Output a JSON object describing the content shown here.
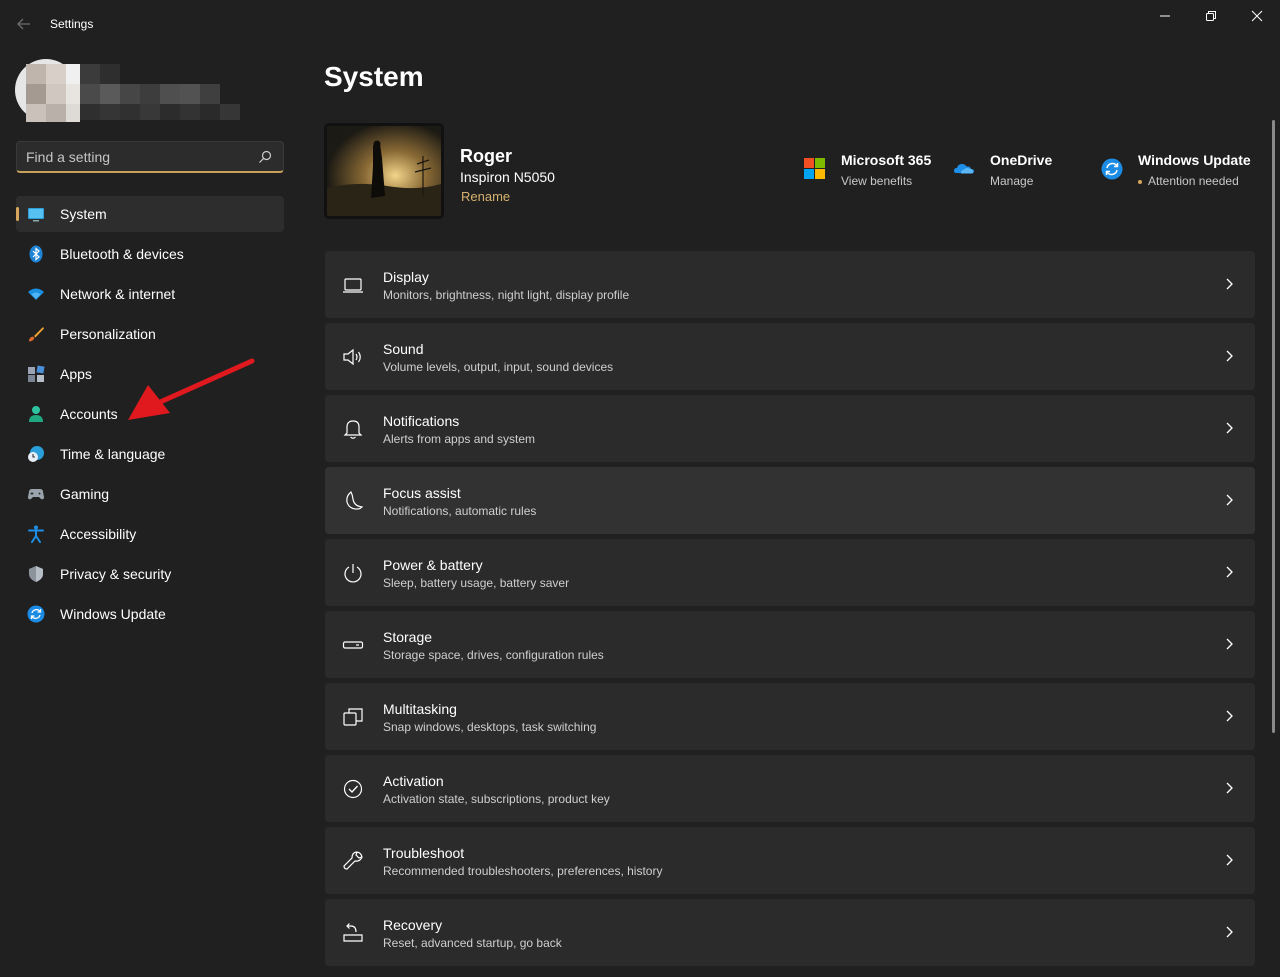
{
  "titlebar": {
    "app_title": "Settings"
  },
  "search": {
    "placeholder": "Find a setting"
  },
  "sidebar": {
    "items": [
      {
        "label": "System",
        "icon": "system-icon",
        "selected": true
      },
      {
        "label": "Bluetooth & devices",
        "icon": "bluetooth-icon"
      },
      {
        "label": "Network & internet",
        "icon": "wifi-icon"
      },
      {
        "label": "Personalization",
        "icon": "brush-icon"
      },
      {
        "label": "Apps",
        "icon": "apps-icon"
      },
      {
        "label": "Accounts",
        "icon": "account-icon"
      },
      {
        "label": "Time & language",
        "icon": "clock-globe-icon"
      },
      {
        "label": "Gaming",
        "icon": "gamepad-icon"
      },
      {
        "label": "Accessibility",
        "icon": "accessibility-icon"
      },
      {
        "label": "Privacy & security",
        "icon": "shield-icon"
      },
      {
        "label": "Windows Update",
        "icon": "windows-update-icon"
      }
    ]
  },
  "main": {
    "title": "System",
    "device": {
      "name": "Roger",
      "model": "Inspiron N5050",
      "rename_label": "Rename"
    },
    "quick_links": {
      "ms365": {
        "title": "Microsoft 365",
        "subtitle": "View benefits"
      },
      "onedrive": {
        "title": "OneDrive",
        "subtitle": "Manage"
      },
      "windows_update": {
        "title": "Windows Update",
        "subtitle": "Attention needed"
      }
    },
    "cards": [
      {
        "title": "Display",
        "subtitle": "Monitors, brightness, night light, display profile",
        "icon": "display-icon"
      },
      {
        "title": "Sound",
        "subtitle": "Volume levels, output, input, sound devices",
        "icon": "speaker-icon"
      },
      {
        "title": "Notifications",
        "subtitle": "Alerts from apps and system",
        "icon": "bell-icon"
      },
      {
        "title": "Focus assist",
        "subtitle": "Notifications, automatic rules",
        "icon": "moon-icon"
      },
      {
        "title": "Power & battery",
        "subtitle": "Sleep, battery usage, battery saver",
        "icon": "power-icon"
      },
      {
        "title": "Storage",
        "subtitle": "Storage space, drives, configuration rules",
        "icon": "storage-icon"
      },
      {
        "title": "Multitasking",
        "subtitle": "Snap windows, desktops, task switching",
        "icon": "multitasking-icon"
      },
      {
        "title": "Activation",
        "subtitle": "Activation state, subscriptions, product key",
        "icon": "check-circle-icon"
      },
      {
        "title": "Troubleshoot",
        "subtitle": "Recommended troubleshooters, preferences, history",
        "icon": "wrench-icon"
      },
      {
        "title": "Recovery",
        "subtitle": "Reset, advanced startup, go back",
        "icon": "recovery-icon"
      }
    ]
  },
  "colors": {
    "background": "#202020",
    "card": "#2b2b2b",
    "accent": "#d6a65c",
    "annotation_arrow": "#e0191f"
  }
}
